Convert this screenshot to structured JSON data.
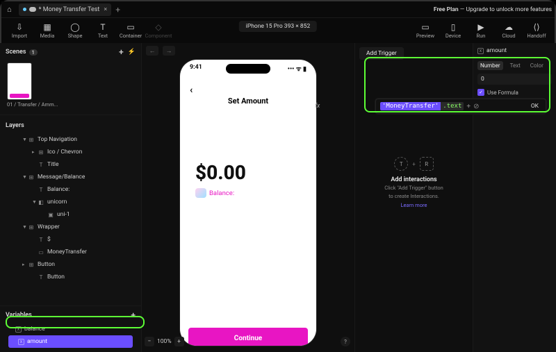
{
  "tab": {
    "title": "* Money Transfer Test"
  },
  "free_plan": {
    "bold": "Free Plan",
    "rest": " — Upgrade to unlock more features"
  },
  "tools": {
    "import": "Import",
    "media": "Media",
    "shape": "Shape",
    "text": "Text",
    "container": "Container",
    "component": "Component",
    "preview": "Preview",
    "device": "Device",
    "run": "Run",
    "cloud": "Cloud",
    "handoff": "Handoff"
  },
  "device_label": "iPhone 15 Pro  393 × 852",
  "scenes": {
    "title": "Scenes",
    "count": "1",
    "thumb_name": "01 / Transfer / Amm..."
  },
  "layers": {
    "title": "Layers",
    "tree": [
      {
        "lvl": 1,
        "tri": "▼",
        "ico": "⊞",
        "label": "Top Navigation"
      },
      {
        "lvl": 2,
        "tri": "▸",
        "ico": "⊞",
        "label": "Ico / Chevron"
      },
      {
        "lvl": 2,
        "tri": "",
        "ico": "T",
        "label": "Title"
      },
      {
        "lvl": 1,
        "tri": "▼",
        "ico": "⊞",
        "label": "Message/Balance"
      },
      {
        "lvl": 2,
        "tri": "",
        "ico": "T",
        "label": "Balance:"
      },
      {
        "lvl": 2,
        "tri": "▼",
        "ico": "◧",
        "label": "unicorn"
      },
      {
        "lvl": 3,
        "tri": "",
        "ico": "▣",
        "label": "uni-1"
      },
      {
        "lvl": 1,
        "tri": "▼",
        "ico": "⊞",
        "label": "Wrapper"
      },
      {
        "lvl": 2,
        "tri": "",
        "ico": "T",
        "label": "$"
      },
      {
        "lvl": 2,
        "tri": "",
        "ico": "▭",
        "label": "MoneyTransfer"
      },
      {
        "lvl": 1,
        "tri": "▸",
        "ico": "⊞",
        "label": "Button"
      },
      {
        "lvl": 2,
        "tri": "",
        "ico": "T",
        "label": "Button"
      }
    ]
  },
  "variables": {
    "title": "Variables",
    "items": [
      {
        "name": "balance",
        "selected": false
      },
      {
        "name": "amount",
        "selected": true
      }
    ]
  },
  "canvas": {
    "zoom": "100%",
    "phone": {
      "time": "9:41",
      "title": "Set Amount",
      "amount": "$0.00",
      "balance_label": "Balance:",
      "continue": "Continue"
    }
  },
  "interactions": {
    "add_trigger": "Add Trigger",
    "heading": "Add interactions",
    "sub1": "Click \"Add Trigger\" button",
    "sub2": "to create Interactions.",
    "learn": "Learn more",
    "formula": {
      "token1": "'MoneyTransfer'",
      "token2": ".text",
      "ok": "OK"
    }
  },
  "inspector": {
    "var_name": "amount",
    "tabs": {
      "number": "Number",
      "text": "Text",
      "color": "Color"
    },
    "value": "0",
    "use_formula": "Use Formula"
  }
}
